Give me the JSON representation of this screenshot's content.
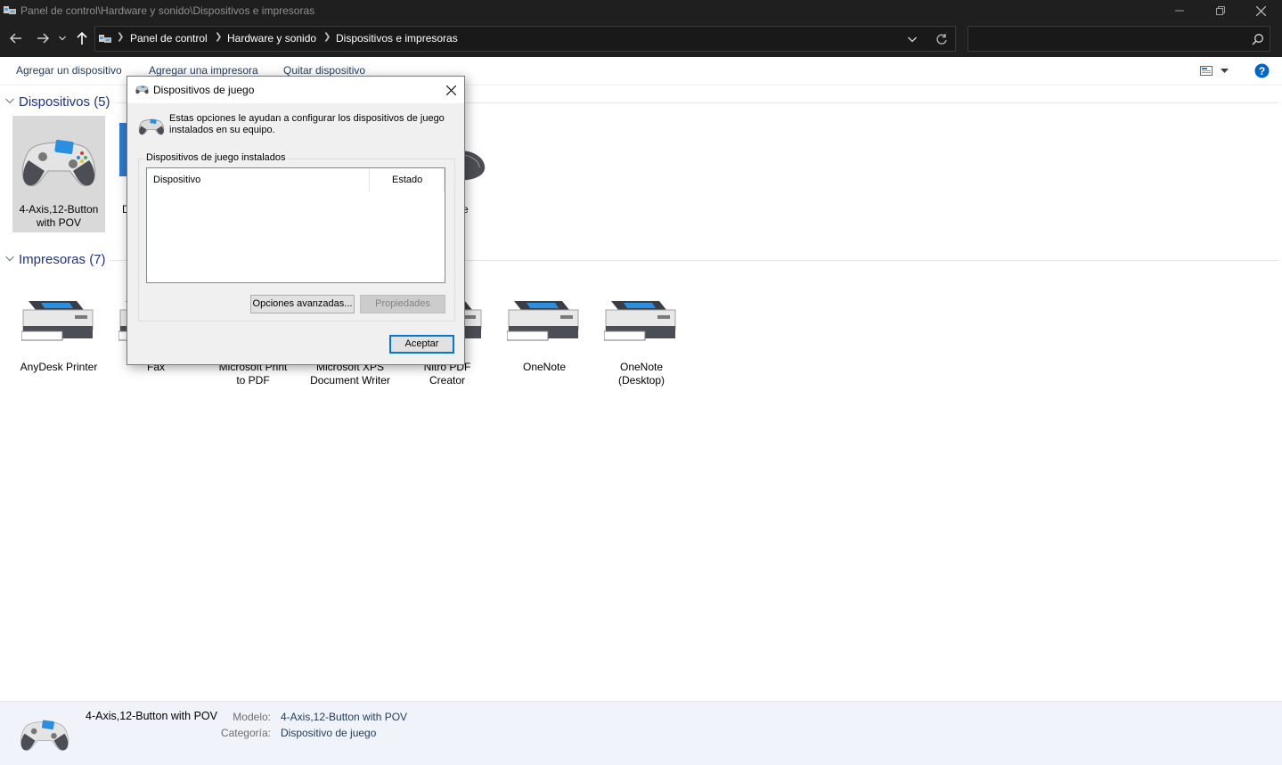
{
  "window": {
    "title": "Panel de control\\Hardware y sonido\\Dispositivos e impresoras"
  },
  "address": {
    "crumbs": [
      "Panel de control",
      "Hardware y sonido",
      "Dispositivos e impresoras"
    ],
    "search_placeholder": ""
  },
  "commands": {
    "add_device": "Agregar un dispositivo",
    "add_printer": "Agregar una impresora",
    "remove_device": "Quitar dispositivo"
  },
  "devices": {
    "header": "Dispositivos (5)",
    "items": [
      {
        "label_line1": "4-Axis,12-Button",
        "label_line2": "with POV"
      },
      {
        "label_line1": "D",
        "label_line2": ""
      },
      {
        "label_line1": "se",
        "label_line2": ""
      }
    ]
  },
  "printers": {
    "header": "Impresoras (7)",
    "items": [
      {
        "label_line1": "AnyDesk Printer",
        "label_line2": ""
      },
      {
        "label_line1": "Fax",
        "label_line2": ""
      },
      {
        "label_line1": "Microsoft Print",
        "label_line2": "to PDF"
      },
      {
        "label_line1": "Microsoft XPS",
        "label_line2": "Document Writer"
      },
      {
        "label_line1": "Nitro PDF",
        "label_line2": "Creator"
      },
      {
        "label_line1": "OneNote",
        "label_line2": ""
      },
      {
        "label_line1": "OneNote",
        "label_line2": "(Desktop)"
      }
    ]
  },
  "details": {
    "name": "4-Axis,12-Button with POV",
    "model_key": "Modelo:",
    "model_value": "4-Axis,12-Button with POV",
    "category_key": "Categoría:",
    "category_value": "Dispositivo de juego"
  },
  "dialog": {
    "title": "Dispositivos de juego",
    "description": "Estas opciones le ayudan a configurar los dispositivos de juego instalados en su equipo.",
    "group_label": "Dispositivos de juego instalados",
    "col_device": "Dispositivo",
    "col_status": "Estado",
    "advanced_button": "Opciones avanzadas...",
    "properties_button": "Propiedades",
    "ok_button": "Aceptar"
  },
  "colors": {
    "titlebar_bg": "#1f1f1f",
    "link_blue": "#1e395b",
    "group_header_blue": "#1e3287",
    "selection_bg": "#d9d9d9",
    "details_bg": "#f0f4fa",
    "help_blue": "#0066cc"
  }
}
